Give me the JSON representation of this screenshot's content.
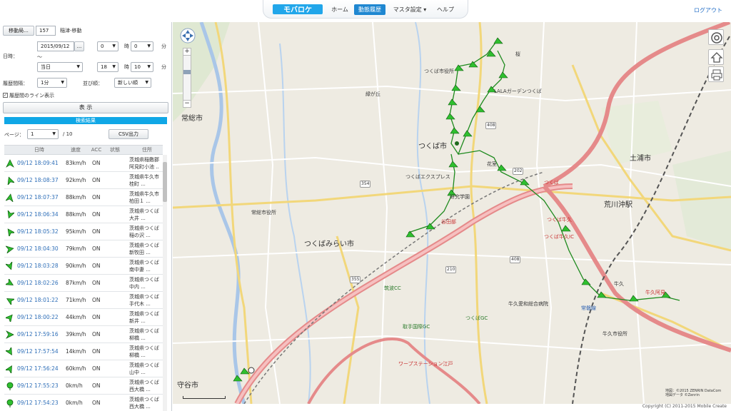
{
  "header": {
    "nav": [
      {
        "label": "ホーム",
        "active": false
      },
      {
        "label": "動態履歴",
        "active": true
      },
      {
        "label": "マスタ設定 ▾",
        "active": false
      },
      {
        "label": "ヘルプ",
        "active": false
      }
    ],
    "logout": "ログアウト",
    "logo_text": "モバロケ"
  },
  "panel": {
    "vehicle_button": "移動局...",
    "vehicle_id": "157",
    "vehicle_name": "稲津-移動",
    "datetime_label": "日時：",
    "from_date": "2015/09/12",
    "from_hour": "0",
    "from_min": "0",
    "hour_unit": "時",
    "min_unit": "分",
    "range_mark": "～",
    "to_date": "当日",
    "to_hour": "18",
    "to_min": "10",
    "interval_label": "履歴間隔：",
    "interval_value": "1分",
    "sort_label": "並び順：",
    "sort_value": "新しい順",
    "line_checkbox_label": "履歴間のライン表示",
    "show_button": "表 示",
    "results_label": "検索結果",
    "page_label": "ページ：",
    "page_value": "1",
    "page_total": "/ 10",
    "csv_button": "CSV出力",
    "columns": [
      "日時",
      "速度",
      "ACC",
      "状態",
      "住所"
    ]
  },
  "rows": [
    {
      "time": "09/12 18:09:41",
      "speed": "83km/h",
      "acc": "ON",
      "addr1": "茨城県稲敷郡",
      "addr2": "阿見町小池 ..",
      "icon": "arrow-icon"
    },
    {
      "time": "09/12 18:08:37",
      "speed": "92km/h",
      "acc": "ON",
      "addr1": "茨城県牛久市",
      "addr2": "桂町 ...",
      "icon": "arrow-icon"
    },
    {
      "time": "09/12 18:07:37",
      "speed": "88km/h",
      "acc": "ON",
      "addr1": "茨城県牛久市",
      "addr2": "柏田１ ...",
      "icon": "arrow-icon"
    },
    {
      "time": "09/12 18:06:34",
      "speed": "88km/h",
      "acc": "ON",
      "addr1": "茨城県つくば",
      "addr2": "大井 ...",
      "icon": "arrow-icon"
    },
    {
      "time": "09/12 18:05:32",
      "speed": "95km/h",
      "acc": "ON",
      "addr1": "茨城県つくば",
      "addr2": "稲の沢 ...",
      "icon": "arrow-icon"
    },
    {
      "time": "09/12 18:04:30",
      "speed": "79km/h",
      "acc": "ON",
      "addr1": "茨城県つくば",
      "addr2": "新牧田 ...",
      "icon": "arrow-icon"
    },
    {
      "time": "09/12 18:03:28",
      "speed": "90km/h",
      "acc": "ON",
      "addr1": "茨城県つくば",
      "addr2": "南中妻 ...",
      "icon": "arrow-icon"
    },
    {
      "time": "09/12 18:02:26",
      "speed": "87km/h",
      "acc": "ON",
      "addr1": "茨城県つくば",
      "addr2": "中内 ...",
      "icon": "arrow-icon"
    },
    {
      "time": "09/12 18:01:22",
      "speed": "71km/h",
      "acc": "ON",
      "addr1": "茨城県つくば",
      "addr2": "手代木 ...",
      "icon": "arrow-icon"
    },
    {
      "time": "09/12 18:00:22",
      "speed": "44km/h",
      "acc": "ON",
      "addr1": "茨城県つくば",
      "addr2": "新井 ...",
      "icon": "arrow-icon"
    },
    {
      "time": "09/12 17:59:16",
      "speed": "39km/h",
      "acc": "ON",
      "addr1": "茨城県つくば",
      "addr2": "柳橋 ...",
      "icon": "arrow-icon"
    },
    {
      "time": "09/12 17:57:54",
      "speed": "14km/h",
      "acc": "ON",
      "addr1": "茨城県つくば",
      "addr2": "柳橋 ...",
      "icon": "arrow-icon"
    },
    {
      "time": "09/12 17:56:24",
      "speed": "60km/h",
      "acc": "ON",
      "addr1": "茨城県つくば",
      "addr2": "山中 ...",
      "icon": "arrow-icon"
    },
    {
      "time": "09/12 17:55:23",
      "speed": "0km/h",
      "acc": "ON",
      "addr1": "茨城県つくば",
      "addr2": "西大橋 ...",
      "icon": "pin-icon"
    },
    {
      "time": "09/12 17:54:23",
      "speed": "0km/h",
      "acc": "ON",
      "addr1": "茨城県つくば",
      "addr2": "西大橋 ...",
      "icon": "pin-icon"
    }
  ],
  "map": {
    "labels": {
      "tsukuba": "つくば市",
      "tsukubamirai": "つくばみらい市",
      "joso": "常総市",
      "tsuchiura": "土浦市",
      "arakawaoki": "荒川沖駅",
      "moriya": "守谷市",
      "tsukuba_city_office": "つくば市役所",
      "joso_city_office": "常総市役所",
      "ushiku_city_office": "牛久市役所",
      "tsukuba_station": "つくばエクスプレス",
      "warp_station": "ワープステーション江戸",
      "ushiku": "牛久",
      "ushiku_ic": "牛久阿見",
      "yatabe": "谷田部",
      "tsuchiura_kita": "つくば牛久",
      "kenkyu": "研究学園",
      "banchi": "花室",
      "lala": "LALAガーデンつくば",
      "sakuragawa": "桜",
      "tsukuba_ic": "つくば",
      "iwai": "緑が丘",
      "ushiku_hospital": "牛久愛和総合病院",
      "ushiku_ic_label": "つくば牛久IC",
      "golf1": "取手国際GC",
      "golf2": "つくばGC",
      "golf3": "筑波CC",
      "jr_line": "常磐線"
    },
    "copyright": "地図：©2015 ZENRIN DataCom\n地図データ ©Zenrin",
    "footer": "Copyright (C) 2011-2015 Mobile Create"
  },
  "colors": {
    "nav_active": "#1f87d1",
    "results_bar": "#10a7e6",
    "link": "#2f6fb8",
    "marker_green": "#2fbf2f",
    "route_line": "#1e8a1e",
    "highway": "#e58a8a"
  }
}
